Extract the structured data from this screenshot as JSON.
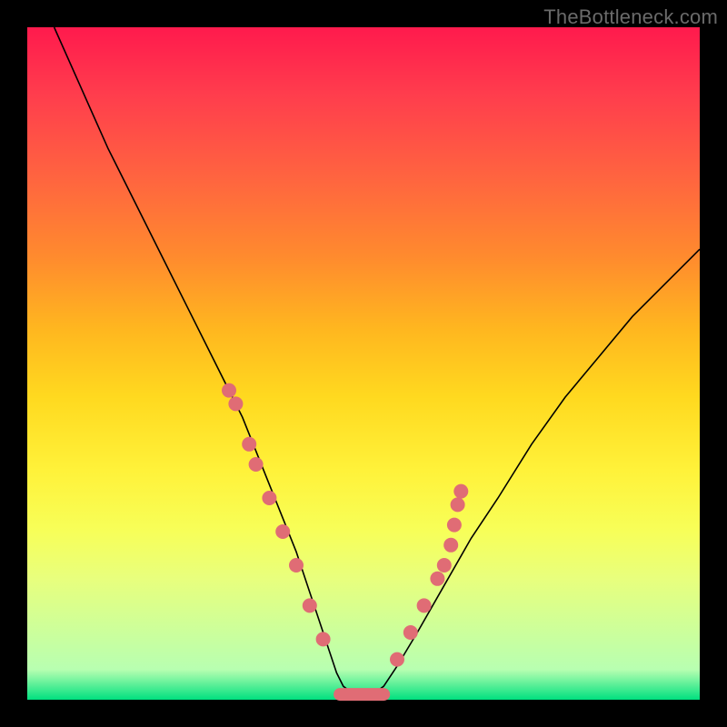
{
  "attribution": "TheBottleneck.com",
  "chart_data": {
    "type": "line",
    "title": "",
    "xlabel": "",
    "ylabel": "",
    "xlim": [
      0,
      100
    ],
    "ylim": [
      0,
      100
    ],
    "grid": false,
    "series": [
      {
        "name": "curve",
        "x": [
          4,
          8,
          12,
          16,
          20,
          24,
          28,
          30,
          32,
          34,
          36,
          38,
          40,
          42,
          43,
          44,
          45,
          46,
          47,
          49,
          51,
          53,
          55,
          58,
          62,
          66,
          70,
          75,
          80,
          85,
          90,
          95,
          100
        ],
        "y": [
          100,
          91,
          82,
          74,
          66,
          58,
          50,
          46,
          42,
          37,
          32,
          27,
          22,
          16,
          13,
          10,
          7,
          4,
          2,
          0.5,
          0.5,
          2,
          5,
          10,
          17,
          24,
          30,
          38,
          45,
          51,
          57,
          62,
          67
        ]
      }
    ],
    "markers": {
      "left_cluster": [
        {
          "x": 30,
          "y": 46
        },
        {
          "x": 31,
          "y": 44
        },
        {
          "x": 33,
          "y": 38
        },
        {
          "x": 34,
          "y": 35
        },
        {
          "x": 36,
          "y": 30
        },
        {
          "x": 38,
          "y": 25
        },
        {
          "x": 40,
          "y": 20
        },
        {
          "x": 42,
          "y": 14
        },
        {
          "x": 44,
          "y": 9
        }
      ],
      "right_cluster": [
        {
          "x": 55,
          "y": 6
        },
        {
          "x": 57,
          "y": 10
        },
        {
          "x": 59,
          "y": 14
        },
        {
          "x": 61,
          "y": 18
        },
        {
          "x": 62,
          "y": 20
        },
        {
          "x": 63,
          "y": 23
        },
        {
          "x": 63.5,
          "y": 26
        },
        {
          "x": 64,
          "y": 29
        },
        {
          "x": 64.5,
          "y": 31
        }
      ],
      "bottom_flat": {
        "x_start": 46.5,
        "x_end": 53,
        "y": 0.8
      }
    }
  }
}
